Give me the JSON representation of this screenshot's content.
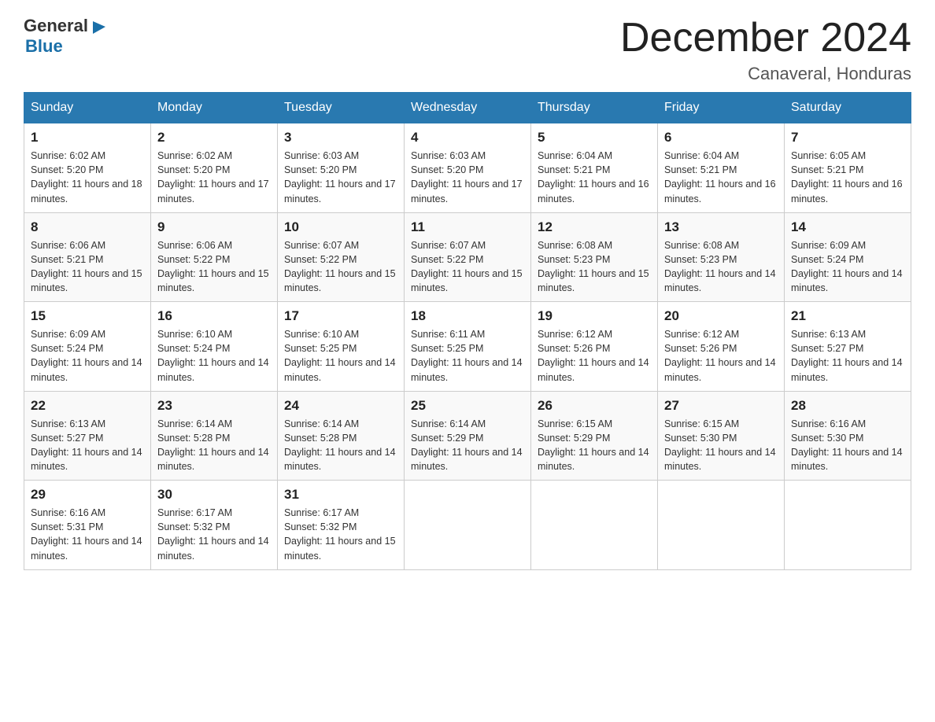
{
  "logo": {
    "general": "General",
    "blue": "Blue",
    "triangle": "▶"
  },
  "header": {
    "title": "December 2024",
    "subtitle": "Canaveral, Honduras"
  },
  "days_of_week": [
    "Sunday",
    "Monday",
    "Tuesday",
    "Wednesday",
    "Thursday",
    "Friday",
    "Saturday"
  ],
  "weeks": [
    [
      {
        "day": "1",
        "sunrise": "Sunrise: 6:02 AM",
        "sunset": "Sunset: 5:20 PM",
        "daylight": "Daylight: 11 hours and 18 minutes."
      },
      {
        "day": "2",
        "sunrise": "Sunrise: 6:02 AM",
        "sunset": "Sunset: 5:20 PM",
        "daylight": "Daylight: 11 hours and 17 minutes."
      },
      {
        "day": "3",
        "sunrise": "Sunrise: 6:03 AM",
        "sunset": "Sunset: 5:20 PM",
        "daylight": "Daylight: 11 hours and 17 minutes."
      },
      {
        "day": "4",
        "sunrise": "Sunrise: 6:03 AM",
        "sunset": "Sunset: 5:20 PM",
        "daylight": "Daylight: 11 hours and 17 minutes."
      },
      {
        "day": "5",
        "sunrise": "Sunrise: 6:04 AM",
        "sunset": "Sunset: 5:21 PM",
        "daylight": "Daylight: 11 hours and 16 minutes."
      },
      {
        "day": "6",
        "sunrise": "Sunrise: 6:04 AM",
        "sunset": "Sunset: 5:21 PM",
        "daylight": "Daylight: 11 hours and 16 minutes."
      },
      {
        "day": "7",
        "sunrise": "Sunrise: 6:05 AM",
        "sunset": "Sunset: 5:21 PM",
        "daylight": "Daylight: 11 hours and 16 minutes."
      }
    ],
    [
      {
        "day": "8",
        "sunrise": "Sunrise: 6:06 AM",
        "sunset": "Sunset: 5:21 PM",
        "daylight": "Daylight: 11 hours and 15 minutes."
      },
      {
        "day": "9",
        "sunrise": "Sunrise: 6:06 AM",
        "sunset": "Sunset: 5:22 PM",
        "daylight": "Daylight: 11 hours and 15 minutes."
      },
      {
        "day": "10",
        "sunrise": "Sunrise: 6:07 AM",
        "sunset": "Sunset: 5:22 PM",
        "daylight": "Daylight: 11 hours and 15 minutes."
      },
      {
        "day": "11",
        "sunrise": "Sunrise: 6:07 AM",
        "sunset": "Sunset: 5:22 PM",
        "daylight": "Daylight: 11 hours and 15 minutes."
      },
      {
        "day": "12",
        "sunrise": "Sunrise: 6:08 AM",
        "sunset": "Sunset: 5:23 PM",
        "daylight": "Daylight: 11 hours and 15 minutes."
      },
      {
        "day": "13",
        "sunrise": "Sunrise: 6:08 AM",
        "sunset": "Sunset: 5:23 PM",
        "daylight": "Daylight: 11 hours and 14 minutes."
      },
      {
        "day": "14",
        "sunrise": "Sunrise: 6:09 AM",
        "sunset": "Sunset: 5:24 PM",
        "daylight": "Daylight: 11 hours and 14 minutes."
      }
    ],
    [
      {
        "day": "15",
        "sunrise": "Sunrise: 6:09 AM",
        "sunset": "Sunset: 5:24 PM",
        "daylight": "Daylight: 11 hours and 14 minutes."
      },
      {
        "day": "16",
        "sunrise": "Sunrise: 6:10 AM",
        "sunset": "Sunset: 5:24 PM",
        "daylight": "Daylight: 11 hours and 14 minutes."
      },
      {
        "day": "17",
        "sunrise": "Sunrise: 6:10 AM",
        "sunset": "Sunset: 5:25 PM",
        "daylight": "Daylight: 11 hours and 14 minutes."
      },
      {
        "day": "18",
        "sunrise": "Sunrise: 6:11 AM",
        "sunset": "Sunset: 5:25 PM",
        "daylight": "Daylight: 11 hours and 14 minutes."
      },
      {
        "day": "19",
        "sunrise": "Sunrise: 6:12 AM",
        "sunset": "Sunset: 5:26 PM",
        "daylight": "Daylight: 11 hours and 14 minutes."
      },
      {
        "day": "20",
        "sunrise": "Sunrise: 6:12 AM",
        "sunset": "Sunset: 5:26 PM",
        "daylight": "Daylight: 11 hours and 14 minutes."
      },
      {
        "day": "21",
        "sunrise": "Sunrise: 6:13 AM",
        "sunset": "Sunset: 5:27 PM",
        "daylight": "Daylight: 11 hours and 14 minutes."
      }
    ],
    [
      {
        "day": "22",
        "sunrise": "Sunrise: 6:13 AM",
        "sunset": "Sunset: 5:27 PM",
        "daylight": "Daylight: 11 hours and 14 minutes."
      },
      {
        "day": "23",
        "sunrise": "Sunrise: 6:14 AM",
        "sunset": "Sunset: 5:28 PM",
        "daylight": "Daylight: 11 hours and 14 minutes."
      },
      {
        "day": "24",
        "sunrise": "Sunrise: 6:14 AM",
        "sunset": "Sunset: 5:28 PM",
        "daylight": "Daylight: 11 hours and 14 minutes."
      },
      {
        "day": "25",
        "sunrise": "Sunrise: 6:14 AM",
        "sunset": "Sunset: 5:29 PM",
        "daylight": "Daylight: 11 hours and 14 minutes."
      },
      {
        "day": "26",
        "sunrise": "Sunrise: 6:15 AM",
        "sunset": "Sunset: 5:29 PM",
        "daylight": "Daylight: 11 hours and 14 minutes."
      },
      {
        "day": "27",
        "sunrise": "Sunrise: 6:15 AM",
        "sunset": "Sunset: 5:30 PM",
        "daylight": "Daylight: 11 hours and 14 minutes."
      },
      {
        "day": "28",
        "sunrise": "Sunrise: 6:16 AM",
        "sunset": "Sunset: 5:30 PM",
        "daylight": "Daylight: 11 hours and 14 minutes."
      }
    ],
    [
      {
        "day": "29",
        "sunrise": "Sunrise: 6:16 AM",
        "sunset": "Sunset: 5:31 PM",
        "daylight": "Daylight: 11 hours and 14 minutes."
      },
      {
        "day": "30",
        "sunrise": "Sunrise: 6:17 AM",
        "sunset": "Sunset: 5:32 PM",
        "daylight": "Daylight: 11 hours and 14 minutes."
      },
      {
        "day": "31",
        "sunrise": "Sunrise: 6:17 AM",
        "sunset": "Sunset: 5:32 PM",
        "daylight": "Daylight: 11 hours and 15 minutes."
      },
      null,
      null,
      null,
      null
    ]
  ]
}
